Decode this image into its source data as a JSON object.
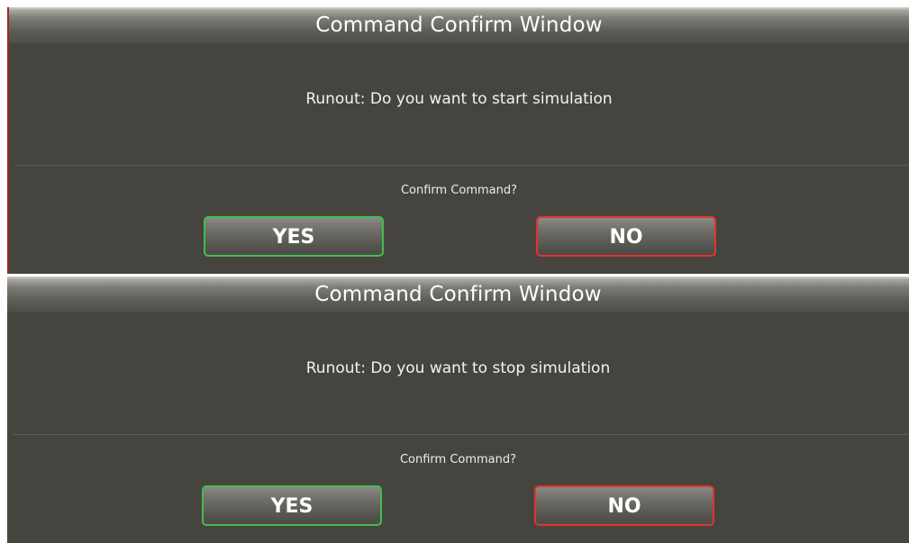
{
  "dialogs": [
    {
      "title": "Command Confirm Window",
      "message": "Runout: Do you want to start simulation",
      "confirm_label": "Confirm Command?",
      "yes_label": "YES",
      "no_label": "NO"
    },
    {
      "title": "Command Confirm Window",
      "message": "Runout: Do you want to stop simulation",
      "confirm_label": "Confirm Command?",
      "yes_label": "YES",
      "no_label": "NO"
    }
  ],
  "colors": {
    "dialog_background": "#46443f",
    "yes_border": "#3fbf4f",
    "no_border": "#e0342e",
    "text": "#ffffff"
  }
}
